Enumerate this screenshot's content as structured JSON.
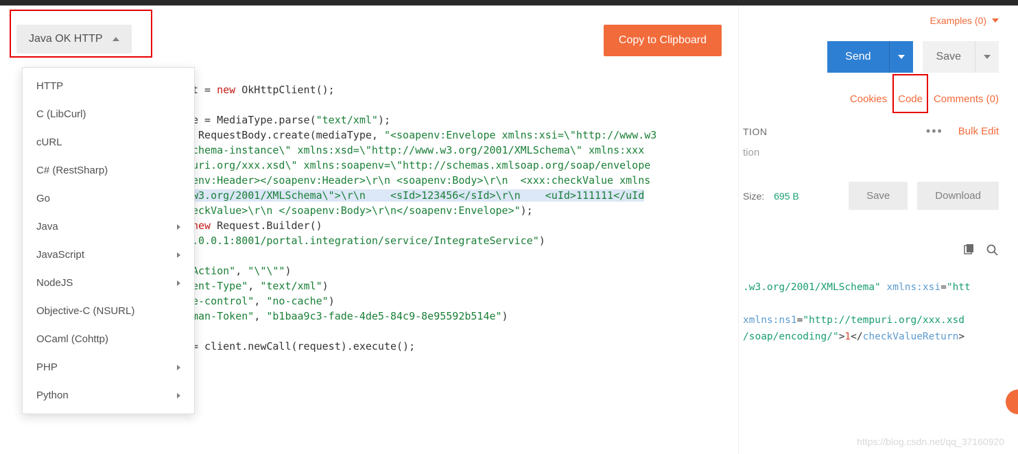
{
  "modal": {
    "lang_label": "Java OK HTTP",
    "copy_label": "Copy to Clipboard",
    "dropdown_items": [
      {
        "label": "HTTP",
        "submenu": false
      },
      {
        "label": "C (LibCurl)",
        "submenu": false
      },
      {
        "label": "cURL",
        "submenu": false
      },
      {
        "label": "C# (RestSharp)",
        "submenu": false
      },
      {
        "label": "Go",
        "submenu": false
      },
      {
        "label": "Java",
        "submenu": true
      },
      {
        "label": "JavaScript",
        "submenu": true
      },
      {
        "label": "NodeJS",
        "submenu": true
      },
      {
        "label": "Objective-C (NSURL)",
        "submenu": false
      },
      {
        "label": "OCaml (Cohttp)",
        "submenu": false
      },
      {
        "label": "PHP",
        "submenu": true
      },
      {
        "label": "Python",
        "submenu": true
      }
    ],
    "code": {
      "l1a": "t = ",
      "l1b": "new",
      "l1c": " OkHttpClient();",
      "l2a": "e = MediaType.parse(",
      "l2b": "\"text/xml\"",
      "l2c": ");",
      "l3a": " RequestBody.create(mediaType, ",
      "l3b": "\"<soapenv:Envelope xmlns:xsi=\\\"http://www.w3",
      "l4": "chema-instance\\\" xmlns:xsd=\\\"http://www.w3.org/2001/XMLSchema\\\" xmlns:xxx",
      "l5": "uri.org/xxx.xsd\\\" xmlns:soapenv=\\\"http://schemas.xmlsoap.org/soap/envelope",
      "l6": "env:Header></soapenv:Header>\\r\\n <soapenv:Body>\\r\\n  <xxx:checkValue xmlns",
      "l7": "w3.org/2001/XMLSchema\\\">\\r\\n    <sId>123456</sId>\\r\\n    <uId>111111</uId",
      "l8": "eckValue>\\r\\n </soapenv:Body>\\r\\n</soapenv:Envelope>\"",
      "l8b": ");",
      "l9a": "new",
      "l9b": " Request.Builder()",
      "l10": ".0.0.1:8001/portal.integration/service/IntegrateService\"",
      "l10b": ")",
      "l11a": "Action\"",
      "l11b": ", ",
      "l11c": "\"\\\"\\\"\"",
      "l11d": ")",
      "l12a": "ent-Type\"",
      "l12b": ", ",
      "l12c": "\"text/xml\"",
      "l12d": ")",
      "l13a": "e-control\"",
      "l13b": ", ",
      "l13c": "\"no-cache\"",
      "l13d": ")",
      "l14a": "man-Token\"",
      "l14b": ", ",
      "l14c": "\"b1baa9c3-fade-4de5-84c9-8e95592b514e\"",
      "l14d": ")",
      "l15": "= client.newCall(request).execute();"
    }
  },
  "right": {
    "examples_label": "Examples (0)",
    "send_label": "Send",
    "save_label": "Save",
    "links": {
      "cookies": "Cookies",
      "code": "Code",
      "comments": "Comments (0)"
    },
    "tion_label": "TION",
    "bulk_label": "Bulk Edit",
    "input_value": "tion",
    "size_label": "Size:",
    "size_value": "695 B",
    "save_btn2": "Save",
    "download_btn": "Download",
    "resp": {
      "l1a": ".w3.org/2001/XMLSchema\"",
      "l1b": " xmlns:xsi",
      "l1c": "=",
      "l1d": "\"htt",
      "l2a": " xmlns:ns1",
      "l2b": "=",
      "l2c": "\"http://tempuri.org/xxx.xsd",
      "l3a": "/soap/encoding/\"",
      "l3b": ">",
      "l3c": "1",
      "l3d": "</",
      "l3e": "checkValueReturn",
      "l3f": ">"
    }
  },
  "watermark": "https://blog.csdn.net/qq_37160920"
}
